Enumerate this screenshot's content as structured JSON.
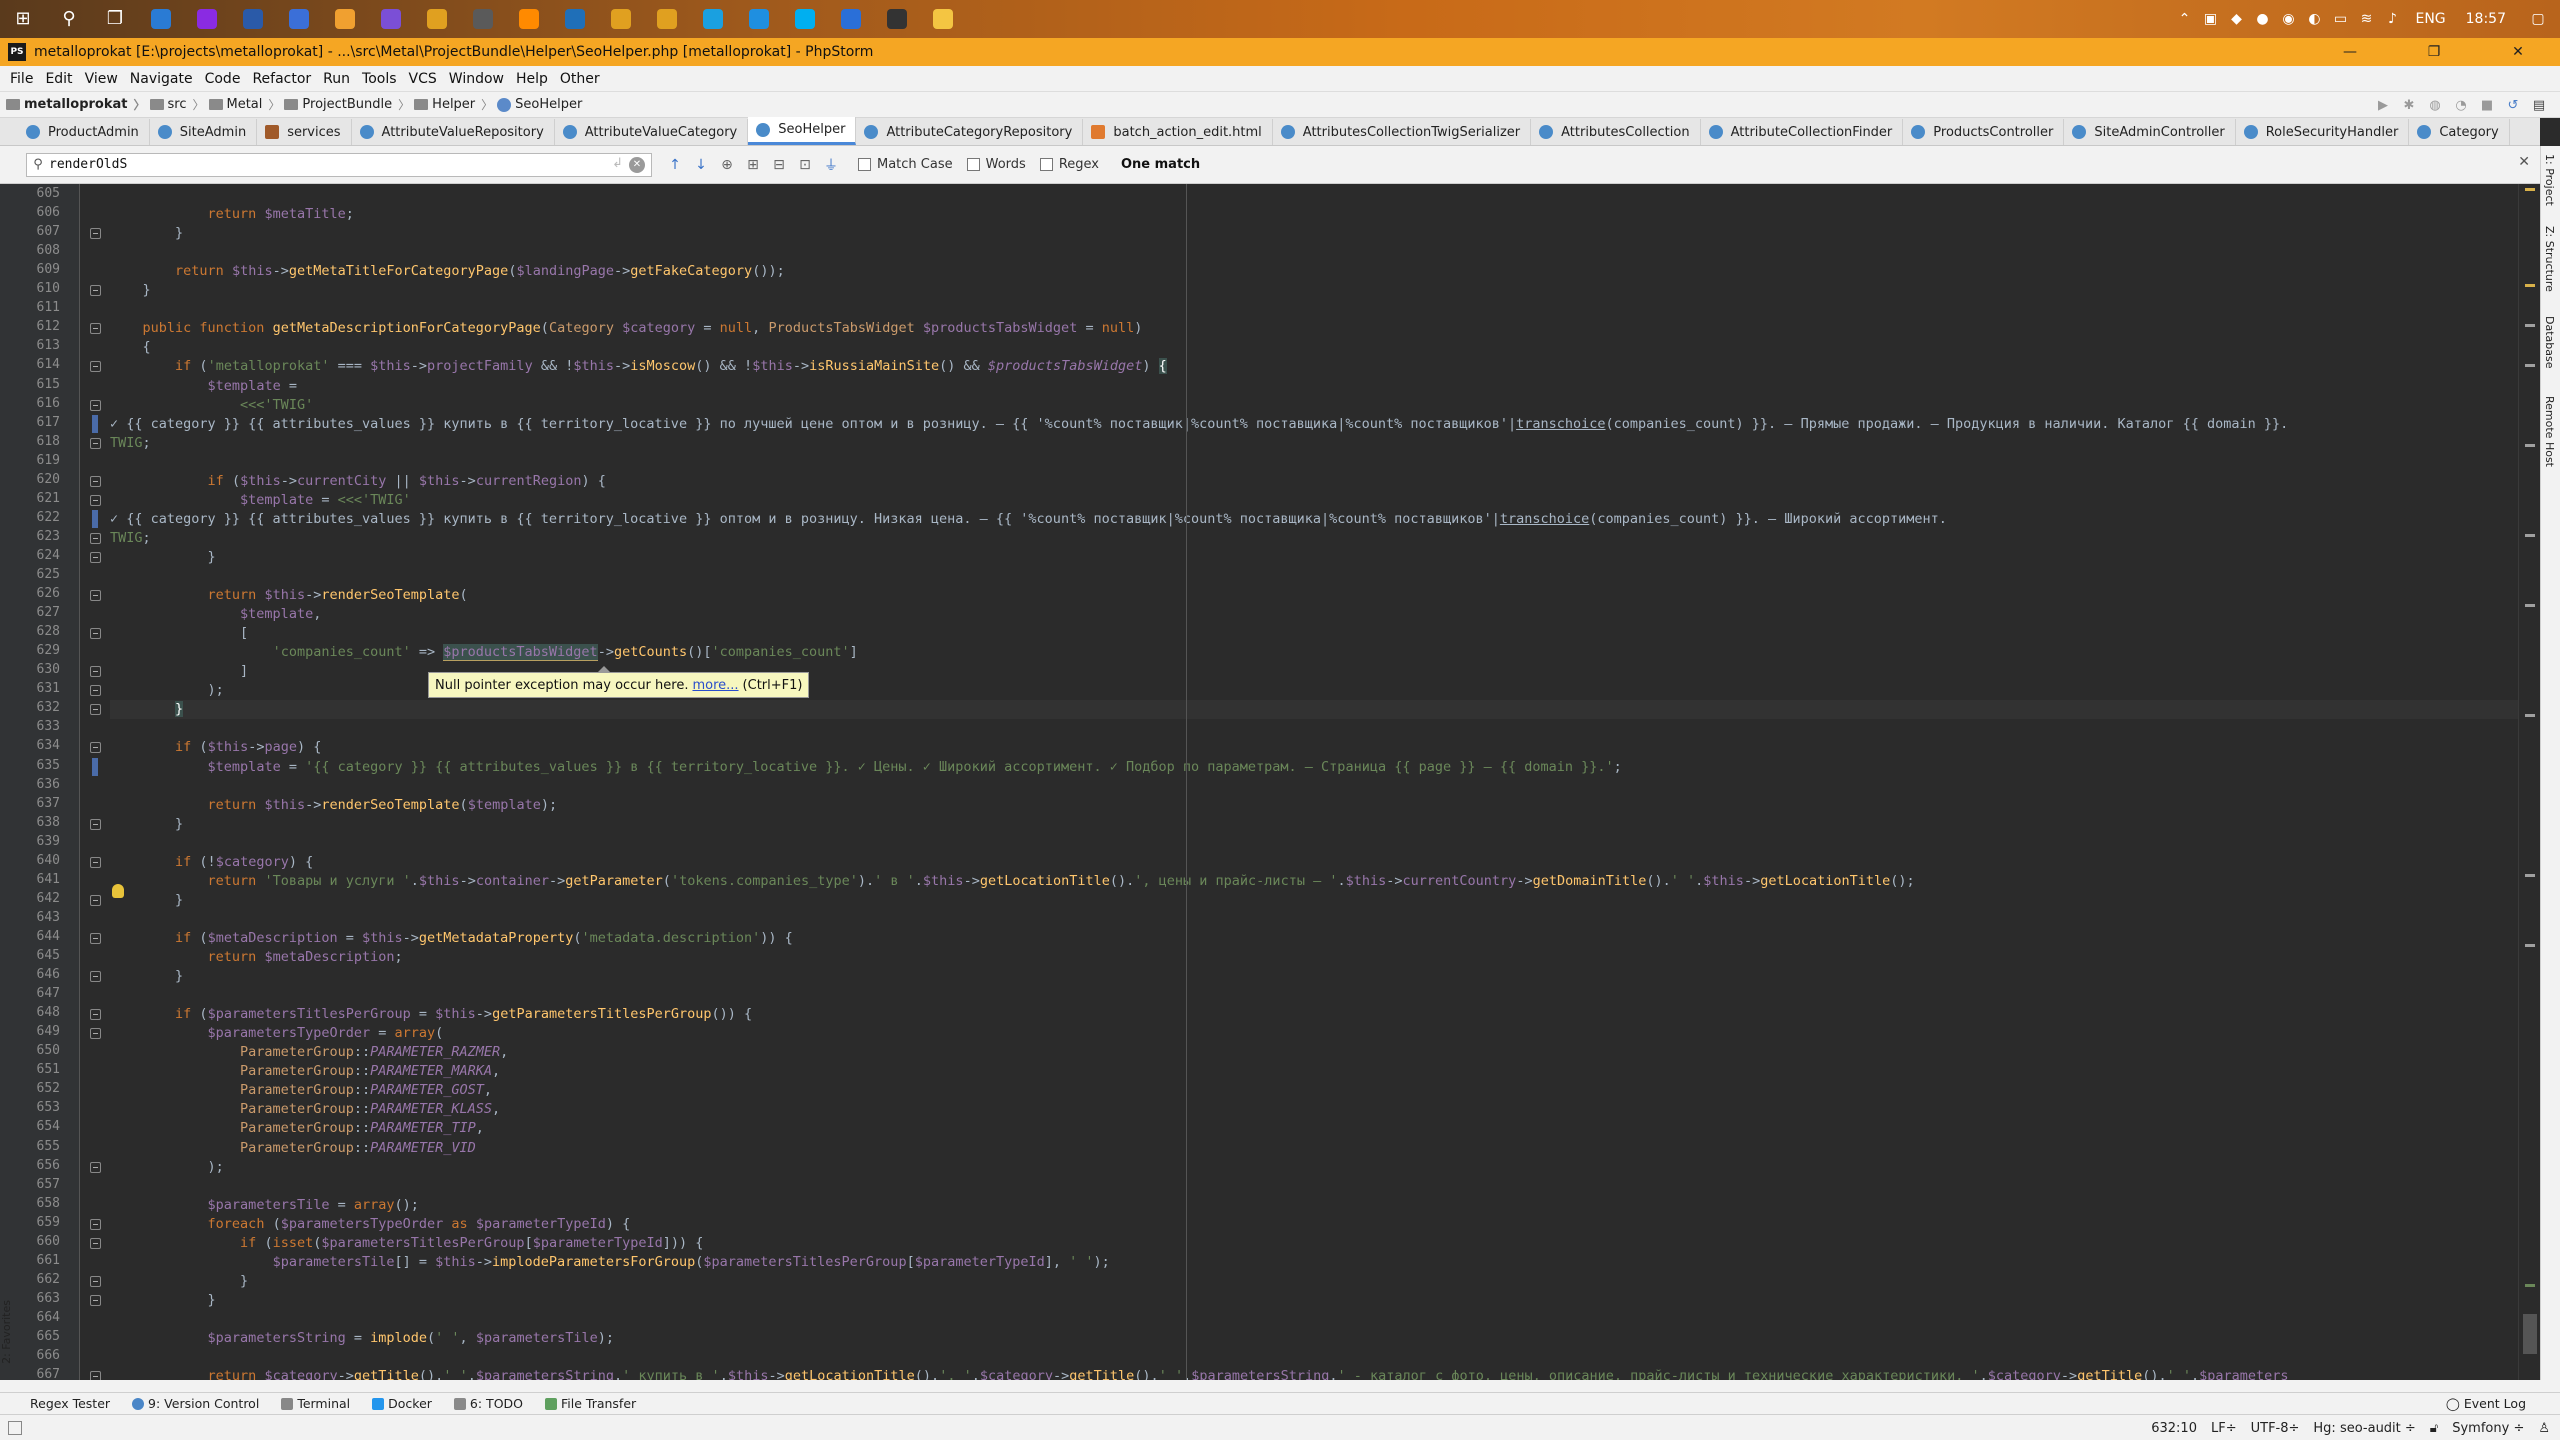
{
  "taskbar": {
    "icons": [
      "windows-start-icon",
      "search-icon",
      "task-view-icon",
      "app-icon",
      "phpstorm-icon",
      "save-icon",
      "app-icon",
      "app-icon",
      "viber-icon",
      "chrome-icon",
      "app-icon",
      "sublime-icon",
      "app-icon",
      "chrome-icon",
      "chrome-icon",
      "app-icon",
      "app-icon",
      "skype-icon",
      "app-icon",
      "terminal-icon",
      "explorer-icon"
    ],
    "language": "ENG",
    "time": "18:57"
  },
  "window": {
    "title": "metalloprokat [E:\\projects\\metalloprokat] - ...\\src\\Metal\\ProjectBundle\\Helper\\SeoHelper.php [metalloprokat] - PhpStorm"
  },
  "menu": [
    "File",
    "Edit",
    "View",
    "Navigate",
    "Code",
    "Refactor",
    "Run",
    "Tools",
    "VCS",
    "Window",
    "Help",
    "Other"
  ],
  "breadcrumb": [
    "metalloprokat",
    "src",
    "Metal",
    "ProjectBundle",
    "Helper",
    "SeoHelper"
  ],
  "tabs": [
    {
      "label": "ProductAdmin",
      "icon": "php-class-icon"
    },
    {
      "label": "SiteAdmin",
      "icon": "php-class-icon"
    },
    {
      "label": "services",
      "icon": "config-icon"
    },
    {
      "label": "AttributeValueRepository",
      "icon": "php-class-icon"
    },
    {
      "label": "AttributeValueCategory",
      "icon": "php-class-icon"
    },
    {
      "label": "SeoHelper",
      "icon": "php-class-icon",
      "active": true
    },
    {
      "label": "AttributeCategoryRepository",
      "icon": "php-class-icon"
    },
    {
      "label": "batch_action_edit.html",
      "icon": "html-icon"
    },
    {
      "label": "AttributesCollectionTwigSerializer",
      "icon": "php-class-icon"
    },
    {
      "label": "AttributesCollection",
      "icon": "php-class-icon"
    },
    {
      "label": "AttributeCollectionFinder",
      "icon": "php-class-icon"
    },
    {
      "label": "ProductsController",
      "icon": "php-class-icon"
    },
    {
      "label": "SiteAdminController",
      "icon": "php-class-icon"
    },
    {
      "label": "RoleSecurityHandler",
      "icon": "php-class-icon"
    },
    {
      "label": "Category",
      "icon": "php-class-icon"
    }
  ],
  "find": {
    "query": "renderOldS",
    "match_case": "Match Case",
    "words": "Words",
    "regex": "Regex",
    "result": "One match"
  },
  "tooltip": {
    "text": "Null pointer exception may occur here.",
    "link": "more...",
    "shortcut": "(Ctrl+F1)"
  },
  "right_stripe": [
    "1: Project",
    "Z: Structure",
    "Database",
    "Remote Host"
  ],
  "left_stripe": [
    "2: Favorites"
  ],
  "bottom_tools": [
    "Regex Tester",
    "9: Version Control",
    "Terminal",
    "Docker",
    "6: TODO",
    "File Transfer"
  ],
  "event_log": "Event Log",
  "status": {
    "position": "632:10",
    "line_sep": "LF÷",
    "encoding": "UTF-8÷",
    "vcs": "Hg: seo-audit ÷",
    "framework": "Symfony ÷"
  },
  "code_lines": [
    {
      "n": "605",
      "html": ""
    },
    {
      "n": "606",
      "html": "            <span class=\"kw\">return</span> <span class=\"var\">$metaTitle</span>;"
    },
    {
      "n": "607",
      "html": "        }"
    },
    {
      "n": "608",
      "html": ""
    },
    {
      "n": "609",
      "html": "        <span class=\"kw\">return</span> <span class=\"var\">$this</span>-><span class=\"fn\">getMetaTitleForCategoryPage</span>(<span class=\"var\">$landingPage</span>-><span class=\"fn\">getFakeCategory</span>());"
    },
    {
      "n": "610",
      "html": "    }"
    },
    {
      "n": "611",
      "html": ""
    },
    {
      "n": "612",
      "html": "    <span class=\"kw\">public function</span> <span class=\"fn\">getMetaDescriptionForCategoryPage</span>(<span class=\"cls\">Category</span> <span class=\"var\">$category</span> = <span class=\"kw\">null</span>, <span class=\"cls\">ProductsTabsWidget</span> <span class=\"var\">$productsTabsWidget</span> = <span class=\"kw\">null</span>)"
    },
    {
      "n": "613",
      "html": "    {"
    },
    {
      "n": "614",
      "html": "        <span class=\"kw\">if</span> (<span class=\"str\">'metalloprokat'</span> === <span class=\"var\">$this</span>-><span class=\"var\">projectFamily</span> &amp;&amp; !<span class=\"var\">$this</span>-><span class=\"fn\">isMoscow</span>() &amp;&amp; !<span class=\"var\">$this</span>-><span class=\"fn\">isRussiaMainSite</span>() &amp;&amp; <span class=\"var ital\">$productsTabsWidget</span>) <span class=\"brace-hl\">{</span>"
    },
    {
      "n": "615",
      "html": "            <span class=\"var\">$template</span> ="
    },
    {
      "n": "616",
      "html": "                <span class=\"str\">&lt;&lt;&lt;'TWIG'</span>"
    },
    {
      "n": "617",
      "html": "<span class=\"twig\">✓ {{ category }} {{ attributes_values }} купить в {{ territory_locative }} по лучшей цене оптом и в розницу. — {{ '%count% поставщик|%count% поставщика|%count% поставщиков'|<span class=\"undl\">transchoice</span>(companies_count) }}. — Прямые продажи. — Продукция в наличии. Каталог {{ domain }}.</span>"
    },
    {
      "n": "618",
      "html": "<span class=\"str\">TWIG</span>;"
    },
    {
      "n": "619",
      "html": ""
    },
    {
      "n": "620",
      "html": "            <span class=\"kw\">if</span> (<span class=\"var\">$this</span>-><span class=\"var\">currentCity</span> || <span class=\"var\">$this</span>-><span class=\"var\">currentRegion</span>) {"
    },
    {
      "n": "621",
      "html": "                <span class=\"var\">$template</span> = <span class=\"str\">&lt;&lt;&lt;'TWIG'</span>"
    },
    {
      "n": "622",
      "html": "<span class=\"twig\">✓ {{ category }} {{ attributes_values }} купить в {{ territory_locative }} оптом и в розницу. Низкая цена. — {{ '%count% поставщик|%count% поставщика|%count% поставщиков'|<span class=\"undl\">transchoice</span>(companies_count) }}. — Широкий ассортимент.</span>"
    },
    {
      "n": "623",
      "html": "<span class=\"str\">TWIG</span>;"
    },
    {
      "n": "624",
      "html": "            }"
    },
    {
      "n": "625",
      "html": ""
    },
    {
      "n": "626",
      "html": "            <span class=\"kw\">return</span> <span class=\"var\">$this</span>-><span class=\"fn\">renderSeoTemplate</span>("
    },
    {
      "n": "627",
      "html": "                <span class=\"var\">$template</span>,"
    },
    {
      "n": "628",
      "html": "                ["
    },
    {
      "n": "629",
      "html": "                    <span class=\"str\">'companies_count'</span> =&gt; <span class=\"hl-var\">$productsTabsWidget</span>-><span class=\"fn\">getCounts</span>()[<span class=\"str\">'companies_count'</span>]"
    },
    {
      "n": "630",
      "html": "                ]"
    },
    {
      "n": "631",
      "html": "            );"
    },
    {
      "n": "632",
      "html": "        <span class=\"brace-hl\">}</span>",
      "current": true
    },
    {
      "n": "633",
      "html": ""
    },
    {
      "n": "634",
      "html": "        <span class=\"kw\">if</span> (<span class=\"var\">$this</span>-><span class=\"var\">page</span>) {"
    },
    {
      "n": "635",
      "html": "            <span class=\"var\">$template</span> = <span class=\"str\">'{{ category }} {{ attributes_values }} в {{ territory_locative }}. ✓ Цены. ✓ Широкий ассортимент. ✓ Подбор по параметрам. — Страница {{ page }} — {{ domain }}.'</span>;"
    },
    {
      "n": "636",
      "html": ""
    },
    {
      "n": "637",
      "html": "            <span class=\"kw\">return</span> <span class=\"var\">$this</span>-><span class=\"fn\">renderSeoTemplate</span>(<span class=\"var\">$template</span>);"
    },
    {
      "n": "638",
      "html": "        }"
    },
    {
      "n": "639",
      "html": ""
    },
    {
      "n": "640",
      "html": "        <span class=\"kw\">if</span> (!<span class=\"var\">$category</span>) {"
    },
    {
      "n": "641",
      "html": "            <span class=\"kw\">return</span> <span class=\"str\">'Товары и услуги '</span>.<span class=\"var\">$this</span>-><span class=\"var\">container</span>-><span class=\"fn\">getParameter</span>(<span class=\"str\">'tokens.companies_type'</span>).<span class=\"str\">' в '</span>.<span class=\"var\">$this</span>-><span class=\"fn\">getLocationTitle</span>().<span class=\"str\">', цены и прайс-листы — '</span>.<span class=\"var\">$this</span>-><span class=\"var\">currentCountry</span>-><span class=\"fn\">getDomainTitle</span>().<span class=\"str\">' '</span>.<span class=\"var\">$this</span>-><span class=\"fn\">getLocationTitle</span>();"
    },
    {
      "n": "642",
      "html": "        }"
    },
    {
      "n": "643",
      "html": ""
    },
    {
      "n": "644",
      "html": "        <span class=\"kw\">if</span> (<span class=\"var\">$metaDescription</span> = <span class=\"var\">$this</span>-><span class=\"fn\">getMetadataProperty</span>(<span class=\"str\">'metadata.description'</span>)) {"
    },
    {
      "n": "645",
      "html": "            <span class=\"kw\">return</span> <span class=\"var\">$metaDescription</span>;"
    },
    {
      "n": "646",
      "html": "        }"
    },
    {
      "n": "647",
      "html": ""
    },
    {
      "n": "648",
      "html": "        <span class=\"kw\">if</span> (<span class=\"var\">$parametersTitlesPerGroup</span> = <span class=\"var\">$this</span>-><span class=\"fn\">getParametersTitlesPerGroup</span>()) {"
    },
    {
      "n": "649",
      "html": "            <span class=\"var\">$parametersTypeOrder</span> = <span class=\"kw\">array</span>("
    },
    {
      "n": "650",
      "html": "                <span class=\"cls\">ParameterGroup</span>::<span class=\"cst\">PARAMETER_RAZMER</span>,"
    },
    {
      "n": "651",
      "html": "                <span class=\"cls\">ParameterGroup</span>::<span class=\"cst\">PARAMETER_MARKA</span>,"
    },
    {
      "n": "652",
      "html": "                <span class=\"cls\">ParameterGroup</span>::<span class=\"cst\">PARAMETER_GOST</span>,"
    },
    {
      "n": "653",
      "html": "                <span class=\"cls\">ParameterGroup</span>::<span class=\"cst\">PARAMETER_KLASS</span>,"
    },
    {
      "n": "654",
      "html": "                <span class=\"cls\">ParameterGroup</span>::<span class=\"cst\">PARAMETER_TIP</span>,"
    },
    {
      "n": "655",
      "html": "                <span class=\"cls\">ParameterGroup</span>::<span class=\"cst\">PARAMETER_VID</span>"
    },
    {
      "n": "656",
      "html": "            );"
    },
    {
      "n": "657",
      "html": ""
    },
    {
      "n": "658",
      "html": "            <span class=\"var\">$parametersTile</span> = <span class=\"kw\">array</span>();"
    },
    {
      "n": "659",
      "html": "            <span class=\"kw\">foreach</span> (<span class=\"var\">$parametersTypeOrder</span> <span class=\"kw\">as</span> <span class=\"var\">$parameterTypeId</span>) {"
    },
    {
      "n": "660",
      "html": "                <span class=\"kw\">if</span> (<span class=\"kw\">isset</span>(<span class=\"var\">$parametersTitlesPerGroup</span>[<span class=\"var\">$parameterTypeId</span>])) {"
    },
    {
      "n": "661",
      "html": "                    <span class=\"var\">$parametersTile</span>[] = <span class=\"var\">$this</span>-><span class=\"fn\">implodeParametersForGroup</span>(<span class=\"var\">$parametersTitlesPerGroup</span>[<span class=\"var\">$parameterTypeId</span>], <span class=\"str\">' '</span>);"
    },
    {
      "n": "662",
      "html": "                }"
    },
    {
      "n": "663",
      "html": "            }"
    },
    {
      "n": "664",
      "html": ""
    },
    {
      "n": "665",
      "html": "            <span class=\"var\">$parametersString</span> = <span class=\"fn\">implode</span>(<span class=\"str\">' '</span>, <span class=\"var\">$parametersTile</span>);"
    },
    {
      "n": "666",
      "html": ""
    },
    {
      "n": "667",
      "html": "            <span class=\"kw\">return</span> <span class=\"var\">$category</span>-><span class=\"fn\">getTitle</span>().<span class=\"str\">' '</span>.<span class=\"var\">$parametersString</span>.<span class=\"str\">' купить в '</span>.<span class=\"var\">$this</span>-><span class=\"fn\">getLocationTitle</span>().<span class=\"str\">'. '</span>.<span class=\"var\">$category</span>-><span class=\"fn\">getTitle</span>().<span class=\"str\">' '</span>.<span class=\"var\">$parametersString</span>.<span class=\"str\">' - каталог с фото, цены, описание, прайс-листы и технические характеристики. '</span>.<span class=\"var\">$category</span>-><span class=\"fn\">getTitle</span>().<span class=\"str\">' '</span>.<span class=\"var\">$parameters</span>"
    },
    {
      "n": "668",
      "html": ""
    }
  ],
  "colors": {
    "editor_bg": "#2b2b2b",
    "keyword": "#cc7832",
    "variable": "#9876aa",
    "string": "#6a8759",
    "function": "#ffc66d",
    "title_bar": "#f5a623",
    "tooltip_bg": "#f7f7bf"
  }
}
